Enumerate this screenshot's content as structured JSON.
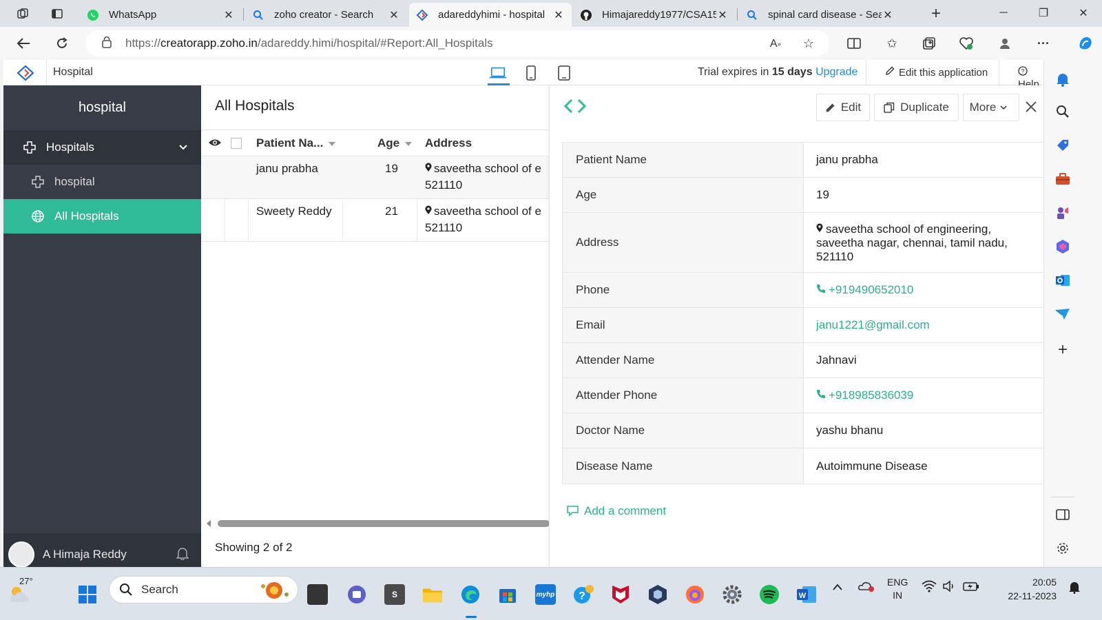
{
  "browser": {
    "tabs": [
      {
        "title": "WhatsApp",
        "active": false
      },
      {
        "title": "zoho creator - Search",
        "active": false
      },
      {
        "title": "adareddyhimi - hospital",
        "active": true
      },
      {
        "title": "Himajareddy1977/CSA15",
        "active": false
      },
      {
        "title": "spinal card disease - Sea",
        "active": false
      }
    ],
    "url": {
      "scheme": "https://",
      "host": "creatorapp.zoho.in",
      "path": "/adareddy.himi/hospital/#Report:All_Hospitals"
    }
  },
  "app_header": {
    "app_name": "Hospital",
    "trial_prefix": "Trial expires in",
    "trial_days": "15 days",
    "upgrade": "Upgrade",
    "edit_app": "Edit this application",
    "help": "Help"
  },
  "sidebar": {
    "brand": "hospital",
    "section": "Hospitals",
    "form_item": "hospital",
    "report_item": "All Hospitals",
    "user_name": "A Himaja Reddy"
  },
  "report": {
    "title": "All Hospitals",
    "columns": [
      "Patient Na...",
      "Age",
      "Address"
    ],
    "rows": [
      {
        "patient": "janu prabha",
        "age": "19",
        "address_line1": "saveetha school of e",
        "address_line2": "521110"
      },
      {
        "patient": "Sweety Reddy",
        "age": "21",
        "address_line1": "saveetha school of e",
        "address_line2": "521110"
      }
    ],
    "showing": "Showing 2 of 2"
  },
  "detail": {
    "buttons": {
      "edit": "Edit",
      "duplicate": "Duplicate",
      "more": "More"
    },
    "fields": [
      {
        "label": "Patient Name",
        "value": "janu prabha"
      },
      {
        "label": "Age",
        "value": "19"
      },
      {
        "label": "Address",
        "value_lines": [
          "saveetha school of engineering,",
          "saveetha nagar, chennai, tamil nadu,",
          "521110"
        ]
      },
      {
        "label": "Phone",
        "value": "+919490652010"
      },
      {
        "label": "Email",
        "value": "janu1221@gmail.com"
      },
      {
        "label": "Attender Name",
        "value": "Jahnavi"
      },
      {
        "label": "Attender Phone",
        "value": "+918985836039"
      },
      {
        "label": "Doctor Name",
        "value": "yashu bhanu"
      },
      {
        "label": "Disease Name",
        "value": "Autoimmune Disease"
      }
    ],
    "add_comment": "Add a comment"
  },
  "taskbar": {
    "weather_temp": "27°",
    "search_placeholder": "Search",
    "language_line1": "ENG",
    "language_line2": "IN",
    "time": "20:05",
    "date": "22-11-2023"
  },
  "colors": {
    "accent_green": "#2fbb97",
    "sidebar_dark": "#373c46",
    "link_blue": "#1d8ce0"
  }
}
